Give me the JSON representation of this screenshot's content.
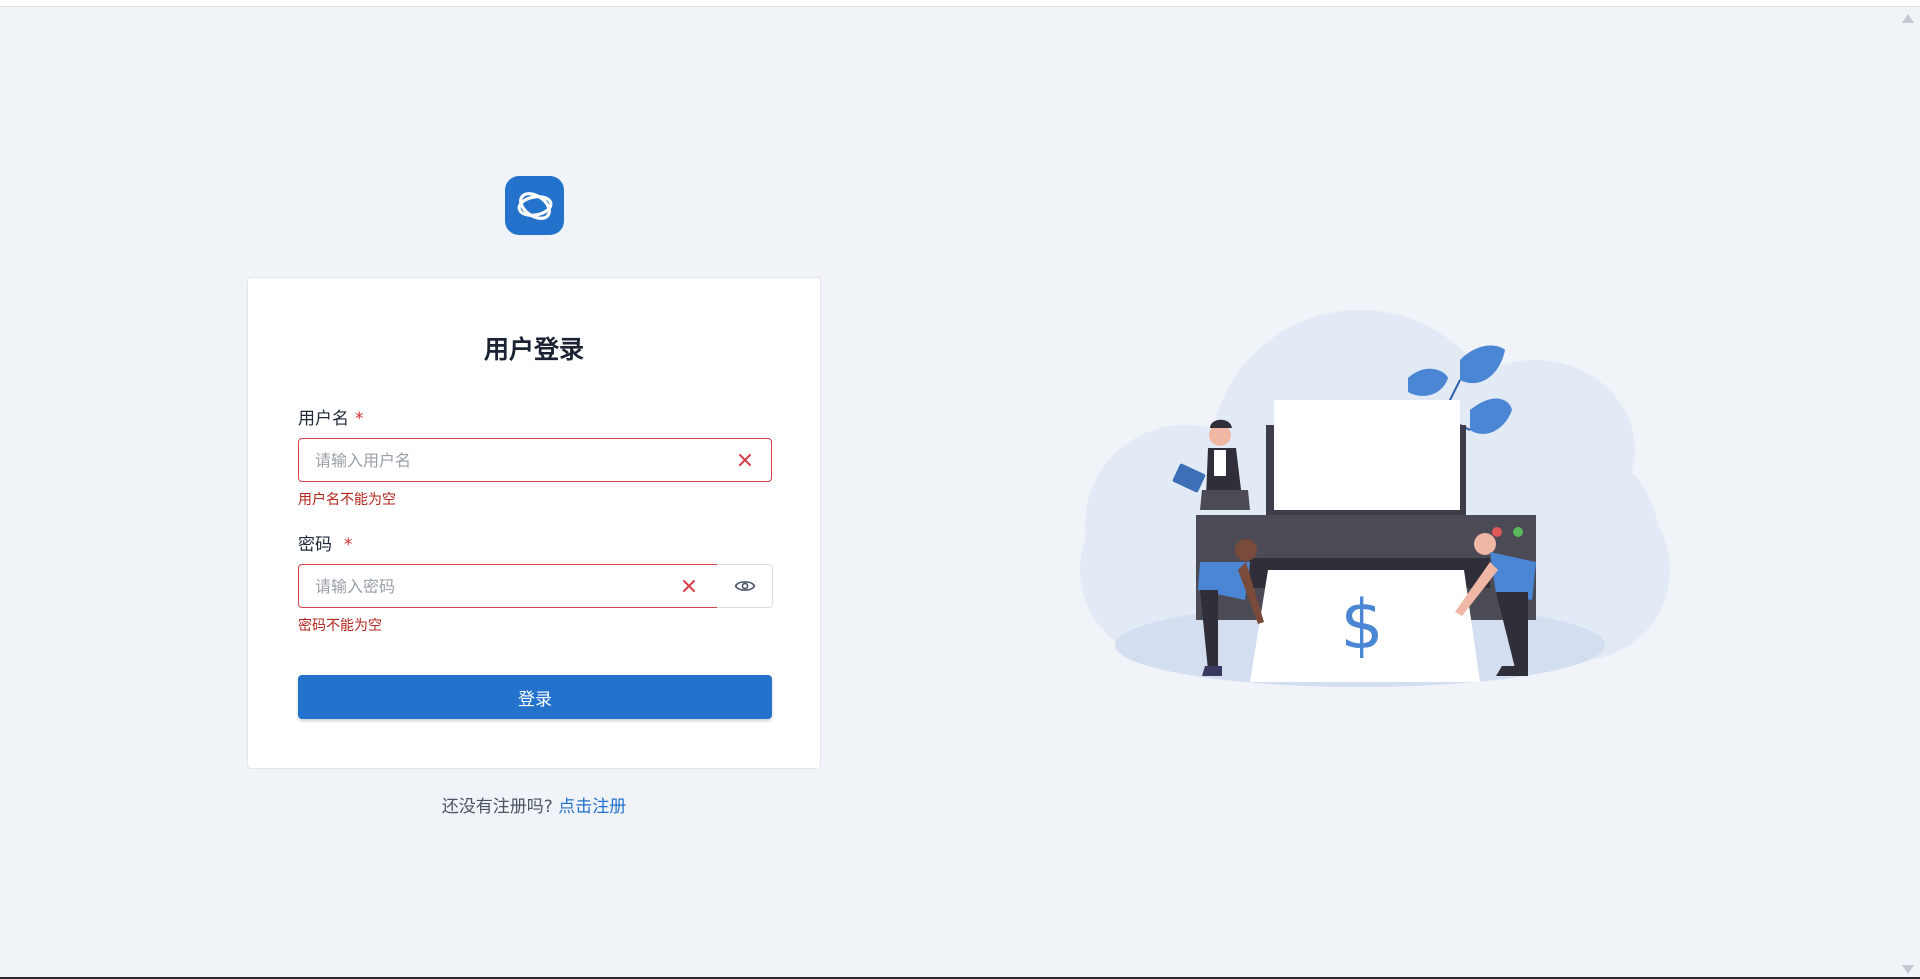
{
  "login": {
    "title": "用户登录",
    "username": {
      "label": "用户名",
      "required_mark": "*",
      "placeholder": "请输入用户名",
      "value": "",
      "error": "用户名不能为空"
    },
    "password": {
      "label": "密码",
      "required_mark": "*",
      "placeholder": "请输入密码",
      "value": "",
      "error": "密码不能为空"
    },
    "submit_label": "登录"
  },
  "register": {
    "prompt": "还没有注册吗?",
    "link_label": "点击注册"
  },
  "icons": {
    "logo": "app-logo-icon",
    "clear": "close-icon",
    "toggle_password": "eye-icon"
  },
  "colors": {
    "brand": "#2372cc",
    "error": "#d3414b",
    "background": "#f0f3f8"
  }
}
